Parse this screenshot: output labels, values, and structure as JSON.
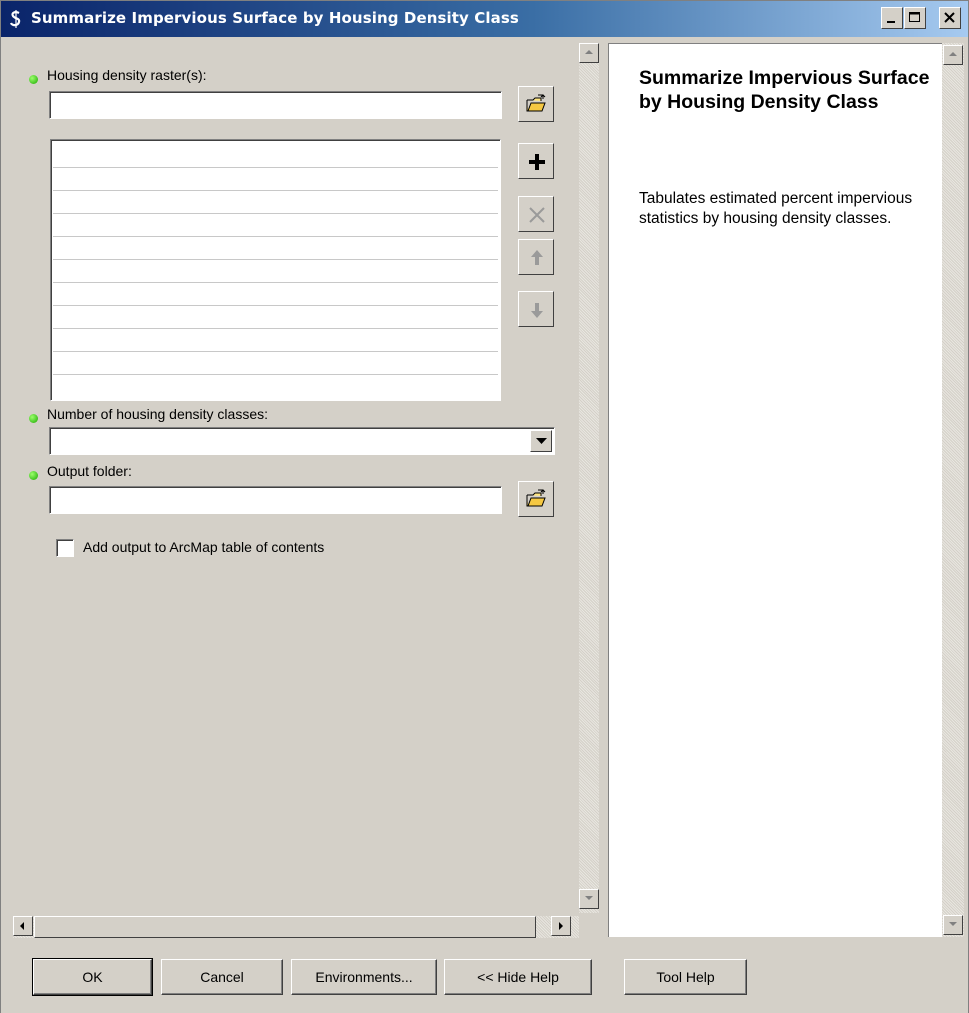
{
  "window": {
    "title": "Summarize Impervious Surface by Housing Density Class"
  },
  "parameters": {
    "housing_raster": {
      "label": "Housing density raster(s):",
      "value": "",
      "list_items": [
        "",
        "",
        "",
        "",
        "",
        "",
        "",
        "",
        "",
        "",
        ""
      ]
    },
    "num_classes": {
      "label": "Number of housing density classes:",
      "selected": ""
    },
    "output_folder": {
      "label": "Output folder:",
      "value": ""
    },
    "add_output": {
      "label": "Add output to ArcMap table of contents",
      "checked": false
    }
  },
  "help": {
    "title": "Summarize Impervious Surface by Housing Density Class",
    "description": "Tabulates estimated percent impervious statistics by housing density classes."
  },
  "buttons": {
    "ok": "OK",
    "cancel": "Cancel",
    "environments": "Environments...",
    "hide_help": "<< Hide Help",
    "tool_help": "Tool Help"
  },
  "colors": {
    "title_gradient_start": "#0a246a",
    "title_gradient_end": "#a6caf0",
    "required_dot": "#1aa800",
    "panel_bg": "#d4d0c8"
  }
}
